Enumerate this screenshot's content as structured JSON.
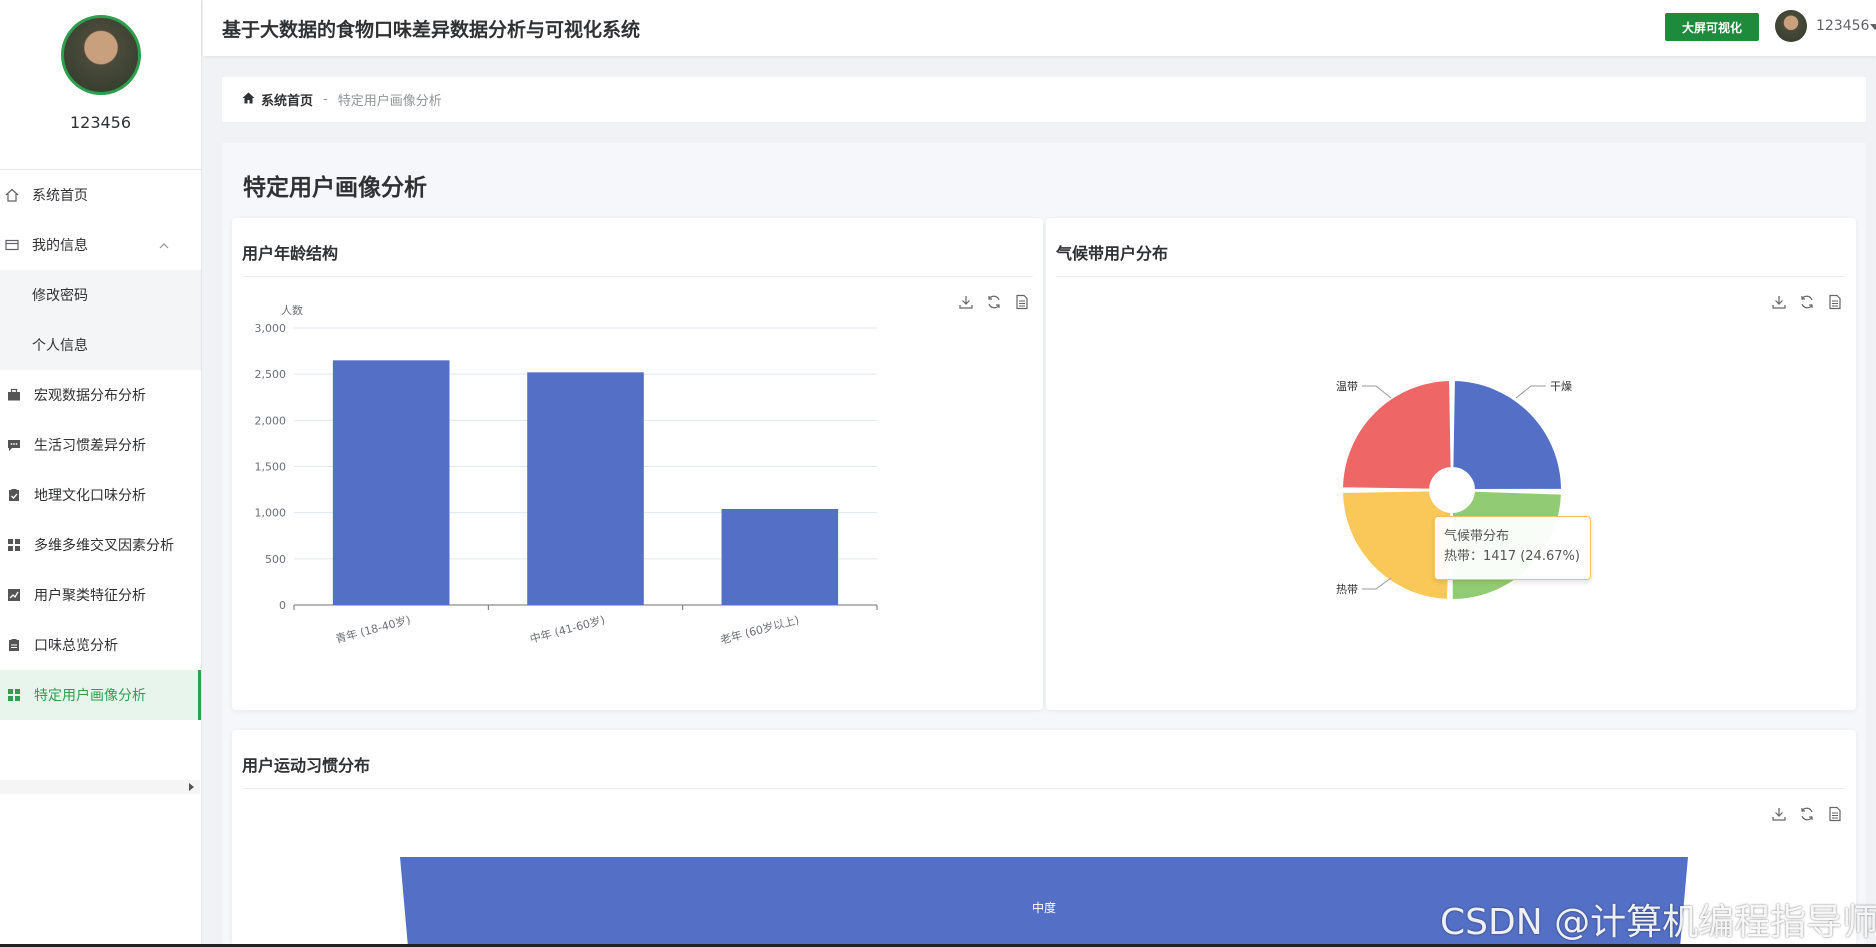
{
  "header": {
    "title": "基于大数据的食物口味差异数据分析与可视化系统",
    "bigscreen_label": "大屏可视化",
    "user": "123456"
  },
  "profile": {
    "name": "123456"
  },
  "sidebar": {
    "items": [
      {
        "label": "系统首页",
        "icon": "home-icon"
      },
      {
        "label": "我的信息",
        "icon": "id-card-icon"
      },
      {
        "label": "修改密码"
      },
      {
        "label": "个人信息"
      },
      {
        "label": "宏观数据分布分析",
        "icon": "briefcase-icon"
      },
      {
        "label": "生活习惯差异分析",
        "icon": "chat-icon"
      },
      {
        "label": "地理文化口味分析",
        "icon": "clipboard-check-icon"
      },
      {
        "label": "多维多维交叉因素分析",
        "icon": "grid-icon"
      },
      {
        "label": "用户聚类特征分析",
        "icon": "trend-icon"
      },
      {
        "label": "口味总览分析",
        "icon": "clipboard-icon"
      },
      {
        "label": "特定用户画像分析",
        "icon": "grid-icon"
      }
    ]
  },
  "breadcrumb": {
    "home": "系统首页",
    "separator": "-",
    "current": "特定用户画像分析"
  },
  "page": {
    "title": "特定用户画像分析"
  },
  "cards": {
    "age": {
      "title": "用户年龄结构"
    },
    "climate": {
      "title": "气候带用户分布"
    },
    "sport": {
      "title": "用户运动习惯分布"
    }
  },
  "tooltip": {
    "title": "气候带分布",
    "line": "热带：1417 (24.67%)"
  },
  "watermark": "CSDN @计算机编程指导师",
  "colors": {
    "accent": "#2e9e4f",
    "bar": "#5470c6",
    "pie": [
      "#5470c6",
      "#91cc75",
      "#fac858",
      "#ee6666"
    ]
  },
  "chart_data": [
    {
      "type": "bar",
      "title": "用户年龄结构",
      "ylabel": "人数",
      "categories": [
        "青年 (18-40岁)",
        "中年 (41-60岁)",
        "老年 (60岁以上)"
      ],
      "values": [
        2650,
        2520,
        1040
      ],
      "yticks": [
        "0",
        "500",
        "1,000",
        "1,500",
        "2,000",
        "2,500",
        "3,000"
      ],
      "ylim": [
        0,
        3000
      ],
      "grid": true
    },
    {
      "type": "pie",
      "title": "气候带用户分布",
      "labels": [
        "干燥",
        "温带",
        "热带"
      ],
      "slices": [
        {
          "name": "干燥",
          "value": 1450
        },
        {
          "name": "",
          "value": 1440
        },
        {
          "name": "热带",
          "value": 1417
        },
        {
          "name": "温带",
          "value": 1437
        }
      ]
    },
    {
      "type": "funnel",
      "title": "用户运动习惯分布",
      "labels": [
        "中度"
      ]
    }
  ]
}
